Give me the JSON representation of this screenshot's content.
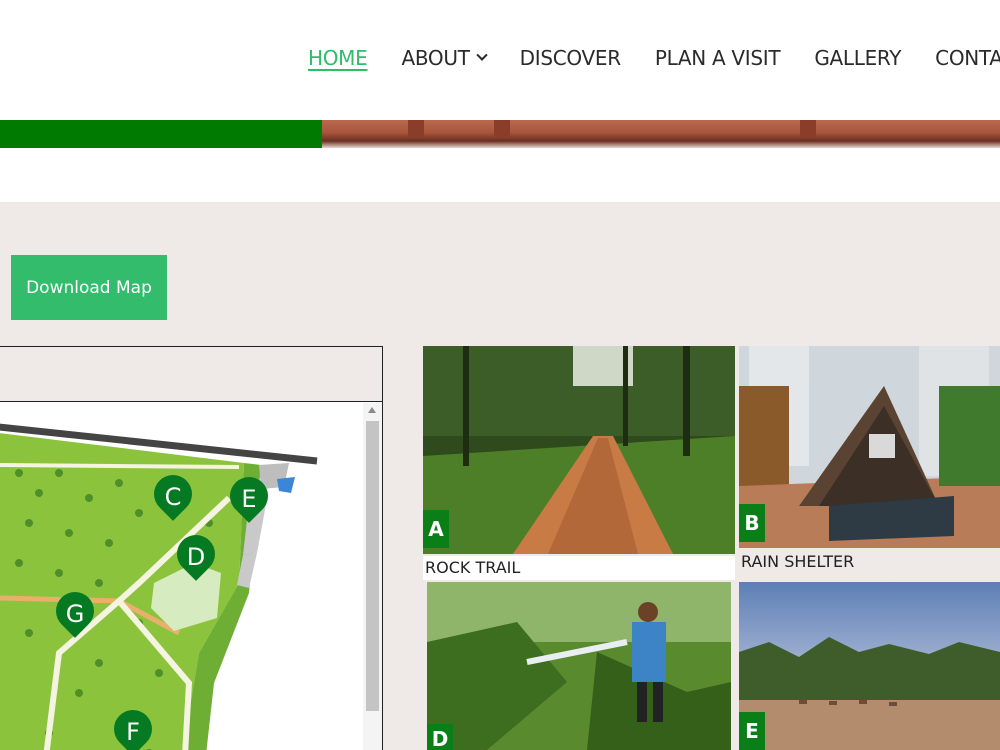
{
  "nav": {
    "items": [
      {
        "label": "HOME",
        "active": true
      },
      {
        "label": "ABOUT",
        "has_dropdown": true
      },
      {
        "label": "DISCOVER"
      },
      {
        "label": "PLAN A VISIT"
      },
      {
        "label": "GALLERY"
      },
      {
        "label": "CONTACT"
      }
    ],
    "colors": {
      "active": "#2ebd6b",
      "default": "#2b2b2b"
    }
  },
  "banner": {
    "accent_color": "#007a00"
  },
  "main": {
    "download_button_label": "Download Map",
    "download_button_color": "#32bc6c"
  },
  "map": {
    "markers": [
      "C",
      "D",
      "E",
      "F",
      "G"
    ],
    "marker_color": "#067a22"
  },
  "gallery": {
    "cards": [
      {
        "letter": "A",
        "caption": "ROCK TRAIL"
      },
      {
        "letter": "B",
        "caption": "RAIN SHELTER"
      },
      {
        "letter": "D",
        "caption": ""
      },
      {
        "letter": "E",
        "caption": ""
      }
    ],
    "badge_color": "#0a7f18"
  }
}
